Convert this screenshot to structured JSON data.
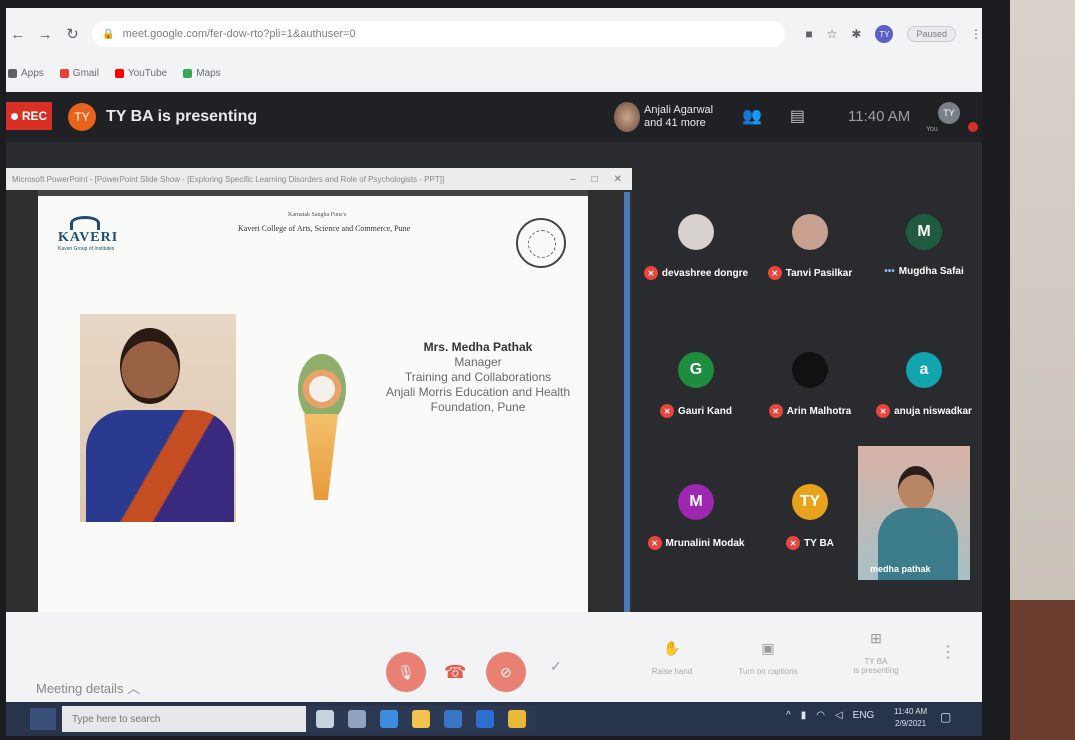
{
  "browser": {
    "url": "meet.google.com/fer-dow-rto?pli=1&authuser=0",
    "pause_label": "Paused",
    "bookmarks": [
      {
        "label": "Apps",
        "color": "#5f6368"
      },
      {
        "label": "Gmail",
        "color": "#ea4335"
      },
      {
        "label": "YouTube",
        "color": "#ff0000"
      },
      {
        "label": "Maps",
        "color": "#34a853"
      }
    ]
  },
  "meet": {
    "rec_label": "REC",
    "presenter_initials": "TY",
    "presenting_text": "TY BA is presenting",
    "others_line1": "Anjali Agarwal",
    "others_line2": "and 41 more",
    "clock": "11:40 AM",
    "me_initials": "TY",
    "me_label": "You"
  },
  "ppt": {
    "window_title": "Microsoft PowerPoint - [PowerPoint Slide Show - [Exploring Specific Learning Disorders and Role of Psychologists - PPT]]",
    "slide": {
      "logo_text": "KAVERI",
      "logo_sub": "Kaveri Group of Institutes",
      "inst_small": "Karnatak Sangha Pune's",
      "inst_name": "Kaveri College of Arts, Science and Commerce, Pune",
      "speaker_name": "Mrs. Medha Pathak",
      "speaker_role": "Manager",
      "speaker_dept": "Training and Collaborations",
      "speaker_org": "Anjali Morris Education and Health Foundation, Pune"
    }
  },
  "participants": [
    {
      "name": "devashree dongre",
      "initial": "",
      "color": "#d6d1cc",
      "indicator": "mic-off"
    },
    {
      "name": "Tanvi Pasilkar",
      "initial": "",
      "color": "#caa091",
      "indicator": "mic-off"
    },
    {
      "name": "Mugdha Safai",
      "initial": "M",
      "color": "#1e5b3f",
      "indicator": "dots"
    },
    {
      "name": "Gauri Kand",
      "initial": "G",
      "color": "#1e8e3e",
      "indicator": "mic-off"
    },
    {
      "name": "Arin Malhotra",
      "initial": "",
      "color": "#111111",
      "indicator": "mic-off"
    },
    {
      "name": "anuja niswadkar",
      "initial": "a",
      "color": "#12a4af",
      "indicator": "mic-off"
    },
    {
      "name": "Mrunalini Modak",
      "initial": "M",
      "color": "#9c27b0",
      "indicator": "mic-off"
    },
    {
      "name": "TY BA",
      "initial": "TY",
      "color": "#e8a21c",
      "indicator": "mic-off"
    }
  ],
  "self_view": {
    "name": "medha pathak"
  },
  "controls": {
    "meeting_details": "Meeting details",
    "raise_hand": "Raise hand",
    "captions": "Turn on captions",
    "presenting_line1": "TY BA",
    "presenting_line2": "is presenting"
  },
  "taskbar": {
    "search_placeholder": "Type here to search",
    "tray_text": "ENG",
    "time": "11:40 AM",
    "date": "2/9/2021"
  }
}
